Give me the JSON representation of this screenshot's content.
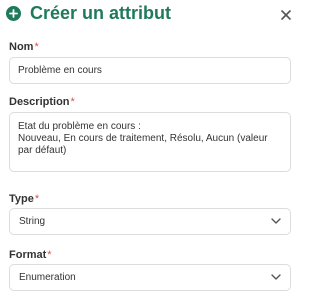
{
  "dialog": {
    "title": "Créer un attribut",
    "icons": {
      "add": "plus-circle-icon",
      "close": "close-icon"
    }
  },
  "form": {
    "nom": {
      "label": "Nom",
      "required_mark": "*",
      "value": "Problème en cours"
    },
    "description": {
      "label": "Description",
      "required_mark": "*",
      "value": "Etat du problème en cours :\nNouveau, En cours de traitement, Résolu, Aucun (valeur par défaut)"
    },
    "type": {
      "label": "Type",
      "required_mark": "*",
      "selected": "String"
    },
    "format": {
      "label": "Format",
      "required_mark": "*",
      "selected": "Enumeration"
    }
  },
  "colors": {
    "accent": "#1f7a5c",
    "required": "#d9534f",
    "border": "#dcdcdc"
  }
}
